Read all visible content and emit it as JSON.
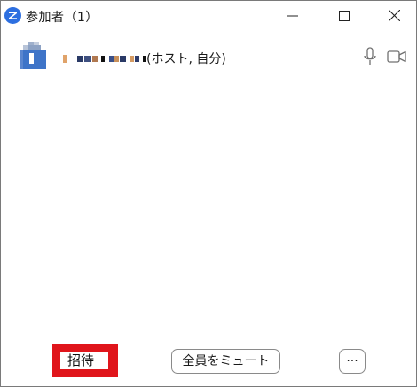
{
  "window": {
    "title": "参加者（1）",
    "app_icon": "zoom-logo-icon",
    "controls": [
      "minimize-icon",
      "maximize-icon",
      "close-icon"
    ]
  },
  "participants": [
    {
      "name_visible_suffix": "(ホスト, 自分)",
      "name_obscured": true,
      "avatar": "avatar-blurred",
      "mic_icon": "microphone-icon",
      "video_icon": "video-camera-icon"
    }
  ],
  "footer": {
    "invite_label": "招待",
    "mute_all_label": "全員をミュート",
    "more_label": "···"
  },
  "colors": {
    "highlight": "#e0151b",
    "zoom_blue": "#2d8cff",
    "avatar_blue": "#3e74c8"
  }
}
